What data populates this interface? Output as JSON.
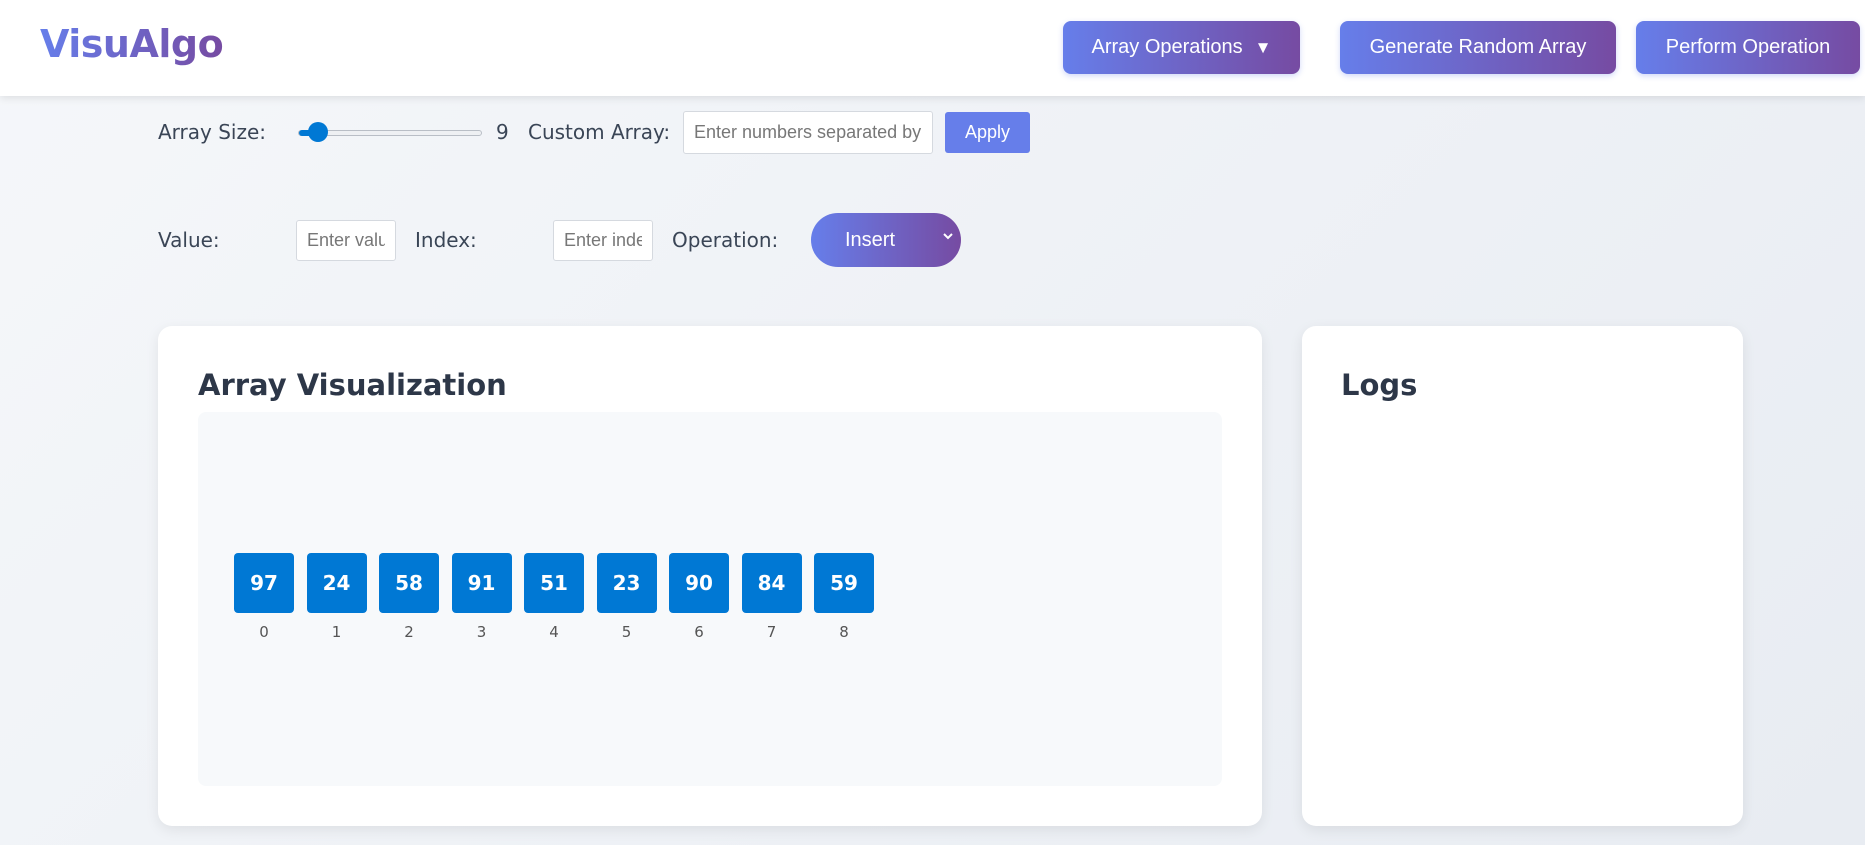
{
  "header": {
    "logo": "VisuAlgo",
    "array_operations_label": "Array Operations",
    "generate_label": "Generate Random Array",
    "perform_label": "Perform Operation"
  },
  "controls": {
    "array_size_label": "Array Size:",
    "array_size_value": "9",
    "array_size_fraction": 0.06,
    "custom_array_label": "Custom Array:",
    "custom_array_placeholder": "Enter numbers separated by commas",
    "apply_label": "Apply",
    "value_label": "Value:",
    "value_placeholder": "Enter value",
    "index_label": "Index:",
    "index_placeholder": "Enter index",
    "operation_label": "Operation:",
    "operation_selected": "Insert"
  },
  "visualization": {
    "title": "Array Visualization",
    "cells": [
      {
        "value": "97",
        "index": "0"
      },
      {
        "value": "24",
        "index": "1"
      },
      {
        "value": "58",
        "index": "2"
      },
      {
        "value": "91",
        "index": "3"
      },
      {
        "value": "51",
        "index": "4"
      },
      {
        "value": "23",
        "index": "5"
      },
      {
        "value": "90",
        "index": "6"
      },
      {
        "value": "84",
        "index": "7"
      },
      {
        "value": "59",
        "index": "8"
      }
    ]
  },
  "logs": {
    "title": "Logs"
  },
  "colors": {
    "accent_start": "#667eea",
    "accent_end": "#764ba2",
    "cell_blue": "#0078d4"
  }
}
